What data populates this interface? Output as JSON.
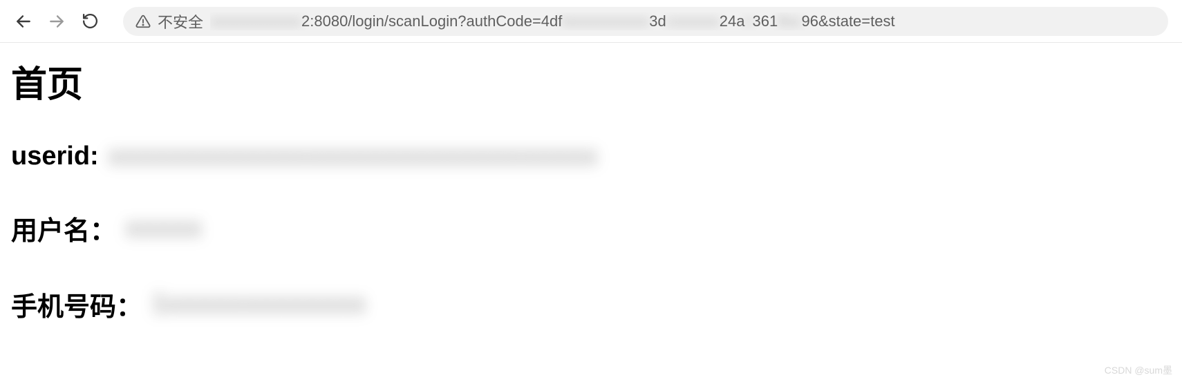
{
  "toolbar": {
    "security_label": "不安全",
    "url_prefix_hidden": "xxxxxxxxxxxx",
    "url_visible_1": "2:8080/login/scanLogin?authCode=4df",
    "url_hidden_1": "lxxxxxxxxxxx",
    "url_visible_2": "3d",
    "url_hidden_2": "cxxxxxx",
    "url_visible_3": "24a",
    "url_hidden_3": "x",
    "url_visible_4": "361",
    "url_hidden_4": "8xx",
    "url_visible_5": "96&state=test"
  },
  "page": {
    "title": "首页",
    "userid_label": "userid:",
    "userid_value": "xxxxxxxxxxxxxxxxxxxxxxxxxxxxxxxx",
    "username_label": "用户名：",
    "username_value": "xxxxx",
    "phone_label": "手机号码：",
    "phone_value": "1xxxxxxxxxxxxx"
  },
  "watermark": "CSDN @sum墨"
}
